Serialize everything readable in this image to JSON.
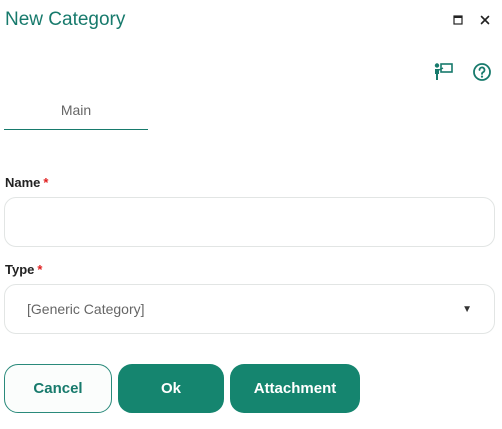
{
  "dialog": {
    "title": "New Category",
    "window_icons": [
      "maximize-icon",
      "close-icon"
    ],
    "toolbar_icons": [
      "presenter-icon",
      "help-icon"
    ]
  },
  "tabs": [
    {
      "label": "Main",
      "active": true
    }
  ],
  "form": {
    "name": {
      "label": "Name",
      "required_mark": "*",
      "value": ""
    },
    "type": {
      "label": "Type",
      "required_mark": "*",
      "value": "[Generic Category]"
    }
  },
  "buttons": {
    "cancel": "Cancel",
    "ok": "Ok",
    "attachment": "Attachment"
  },
  "colors": {
    "accent": "#177a6c",
    "primary_button": "#15856f",
    "required": "#e02020"
  }
}
